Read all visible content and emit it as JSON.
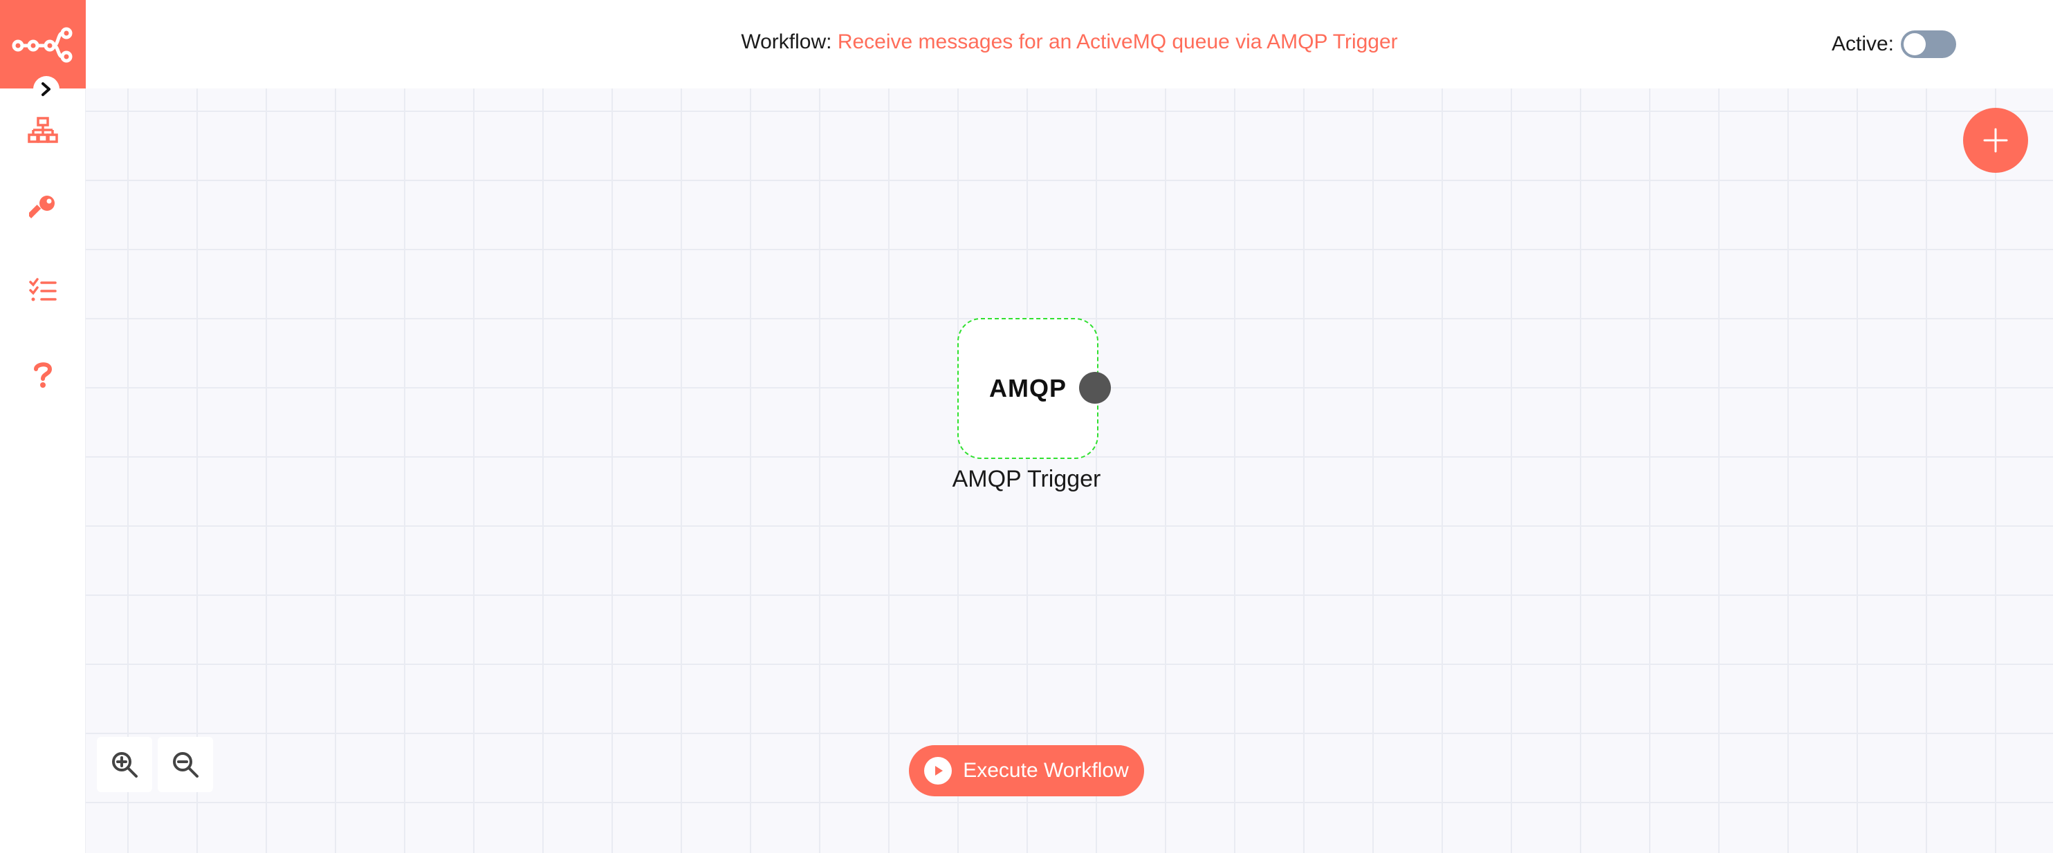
{
  "sidebar": {
    "logo_icon": "n8n-logo-icon",
    "expand_icon": "chevron-right-icon",
    "items": [
      {
        "icon": "workflow-network-icon"
      },
      {
        "icon": "key-icon"
      },
      {
        "icon": "checklist-icon"
      },
      {
        "icon": "question-icon"
      }
    ]
  },
  "header": {
    "workflow_label": "Workflow:",
    "workflow_name": "Receive messages for an ActiveMQ queue via AMQP Trigger",
    "active_label": "Active:",
    "active": false
  },
  "canvas": {
    "add_node_icon": "plus-icon",
    "node": {
      "logo_text": "AMQP",
      "label": "AMQP Trigger"
    },
    "zoom_in_icon": "zoom-in-icon",
    "zoom_out_icon": "zoom-out-icon",
    "execute_label": "Execute Workflow"
  },
  "colors": {
    "accent": "#ff6d5a",
    "node_border": "#30e030",
    "toggle_off": "#8a9bb0",
    "canvas_bg": "#f8f8fc"
  }
}
